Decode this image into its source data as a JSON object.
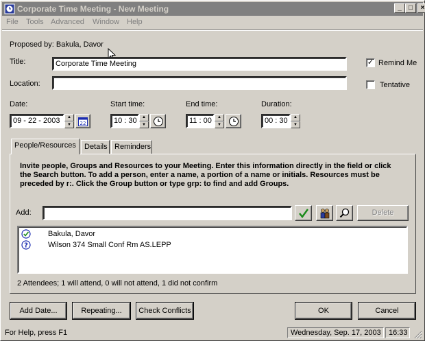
{
  "window": {
    "title": "Corporate Time Meeting - New Meeting",
    "minimize": "_",
    "maximize": "□",
    "close": "×"
  },
  "menu": [
    "File",
    "Tools",
    "Advanced",
    "Window",
    "Help"
  ],
  "proposed_by": "Proposed by: Bakula, Davor",
  "fields": {
    "title_label": "Title:",
    "title_value": "Corporate Time Meeting",
    "location_label": "Location:",
    "location_value": "",
    "remind_me_label": "Remind Me",
    "remind_me_checked": true,
    "tentative_label": "Tentative",
    "tentative_checked": false
  },
  "time": {
    "date_label": "Date:",
    "date_value": "09 - 22 - 2003",
    "start_label": "Start time:",
    "start_value": "10 : 30",
    "end_label": "End time:",
    "end_value": "11 : 00",
    "duration_label": "Duration:",
    "duration_value": "00 : 30"
  },
  "tabs": [
    {
      "label": "People/Resources",
      "active": true
    },
    {
      "label": "Details",
      "active": false
    },
    {
      "label": "Reminders",
      "active": false
    }
  ],
  "instructions": "Invite people, Groups and Resources to your Meeting. Enter this information directly in the field or click the Search button. To add a person, enter a name, a portion of a name or initials. Resources must be preceded by r:. Click the Group button or type grp: to find and add Groups.",
  "add": {
    "label": "Add:",
    "value": "",
    "delete_label": "Delete"
  },
  "attendees": [
    {
      "name": "Bakula, Davor",
      "status_icon": "check-circle-icon",
      "status_glyph": "✓"
    },
    {
      "name": "Wilson 374 Small Conf Rm AS.LEPP",
      "status_icon": "question-circle-icon",
      "status_glyph": "?"
    }
  ],
  "summary": "2 Attendees; 1 will attend, 0 will not attend, 1 did not confirm",
  "buttons": {
    "add_date": "Add Date...",
    "repeating": "Repeating...",
    "check_conflicts": "Check Conflicts",
    "ok": "OK",
    "cancel": "Cancel"
  },
  "status": {
    "help": "For Help, press F1",
    "date": "Wednesday, Sep. 17, 2003",
    "time": "16:33"
  },
  "colors": {
    "face": "#d4d0c8",
    "inactive_title": "#808080",
    "icon_blue": "#1a2bb0",
    "check_green": "#1a8a1a"
  }
}
